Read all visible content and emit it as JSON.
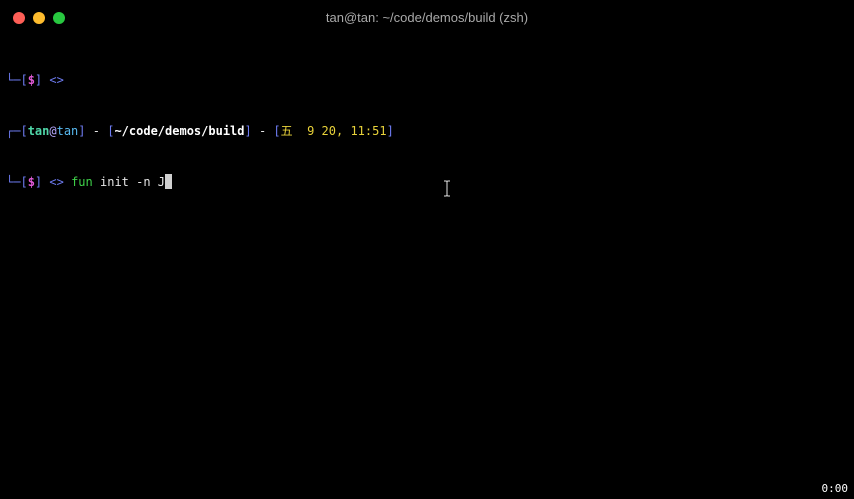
{
  "window": {
    "title": "tan@tan: ~/code/demos/build (zsh)"
  },
  "terminal": {
    "line1": {
      "corner": "└─",
      "bracket_open": "[",
      "dollar": "$",
      "bracket_close": "]",
      "arrow": "<>"
    },
    "line2": {
      "corner": "┌─",
      "bracket_open": "[",
      "user": "tan",
      "at": "@",
      "host": "tan",
      "bracket_close": "]",
      "sep1": " - ",
      "path_open": "[",
      "path": "~/code/demos/build",
      "path_close": "]",
      "sep2": " - ",
      "date_open": "[",
      "date": "五  9 20, 11:51",
      "date_close": "]"
    },
    "line3": {
      "corner": "└─",
      "bracket_open": "[",
      "dollar": "$",
      "bracket_close": "]",
      "arrow": "<>",
      "command": "fun",
      "args": "init -n J"
    }
  },
  "recording": {
    "timer": "0:00"
  },
  "colors": {
    "background": "#000000",
    "close": "#fe5f57",
    "minimize": "#febc2e",
    "maximize": "#28c840",
    "box": "#6e7cf2",
    "dollar": "#e25bd8",
    "user": "#4fd6a8",
    "date": "#e8d23a",
    "command": "#3fd24a"
  },
  "icons": {
    "cursor": "i-beam-text-cursor-icon"
  }
}
